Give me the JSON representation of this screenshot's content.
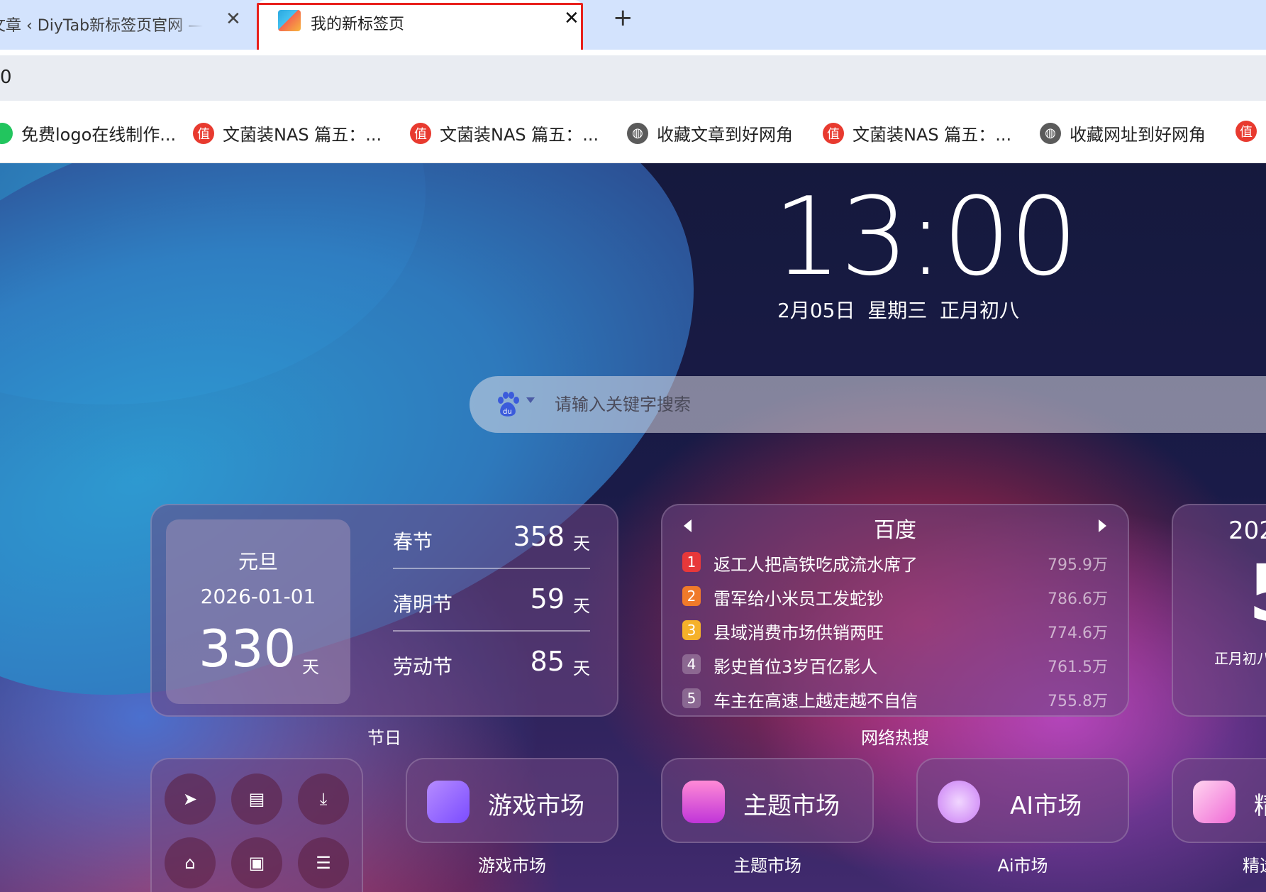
{
  "tabs": [
    {
      "title": "文章 ‹ DiyTab新标签页官网 —"
    },
    {
      "title": "我的新标签页"
    }
  ],
  "omnibox": {
    "url": "0"
  },
  "bookmarks": [
    {
      "label": "免费logo在线制作...",
      "icon": "green-dot-icon"
    },
    {
      "label": "文菌装NAS 篇五：...",
      "icon": "zhi-icon"
    },
    {
      "label": "文菌装NAS 篇五：...",
      "icon": "zhi-icon"
    },
    {
      "label": "收藏文章到好网角",
      "icon": "globe-icon"
    },
    {
      "label": "文菌装NAS 篇五：...",
      "icon": "zhi-icon"
    },
    {
      "label": "收藏网址到好网角",
      "icon": "globe-icon"
    },
    {
      "label": "",
      "icon": "zhi-icon"
    }
  ],
  "clock": {
    "time": "13:00",
    "date": "2月05日  星期三  正月初八"
  },
  "search": {
    "placeholder": "请输入关键字搜索",
    "engine": "baidu-icon"
  },
  "holiday": {
    "main": {
      "name": "元旦",
      "date": "2026-01-01",
      "days": "330",
      "unit": "天"
    },
    "rows": [
      {
        "name": "春节",
        "days": "358",
        "unit": "天"
      },
      {
        "name": "清明节",
        "days": "59",
        "unit": "天"
      },
      {
        "name": "劳动节",
        "days": "85",
        "unit": "天"
      }
    ],
    "label": "节日"
  },
  "hot": {
    "title": "百度",
    "label": "网络热搜",
    "items": [
      {
        "rank": "1",
        "title": "返工人把高铁吃成流水席了",
        "heat": "795.9万",
        "color": "#e8383a"
      },
      {
        "rank": "2",
        "title": "雷军给小米员工发蛇钞",
        "heat": "786.6万",
        "color": "#f07a2a"
      },
      {
        "rank": "3",
        "title": "县域消费市场供销两旺",
        "heat": "774.6万",
        "color": "#f5b12a"
      },
      {
        "rank": "4",
        "title": "影史首位3岁百亿影人",
        "heat": "761.5万",
        "color": "rgba(255,255,255,0.25)"
      },
      {
        "rank": "5",
        "title": "车主在高速上越走越不自信",
        "heat": "755.8万",
        "color": "rgba(255,255,255,0.25)"
      }
    ]
  },
  "calendar": {
    "year": "202",
    "big": "5",
    "lunar": "正月初八"
  },
  "apps": [
    {
      "title": "游戏市场",
      "label": "游戏市场"
    },
    {
      "title": "主题市场",
      "label": "主题市场"
    },
    {
      "title": "AI市场",
      "label": "Ai市场"
    },
    {
      "title": "精",
      "label": "精选"
    }
  ],
  "tools": [
    "send-icon",
    "book-icon",
    "download-icon",
    "home-icon",
    "search-doc-icon",
    "schedule-icon"
  ]
}
